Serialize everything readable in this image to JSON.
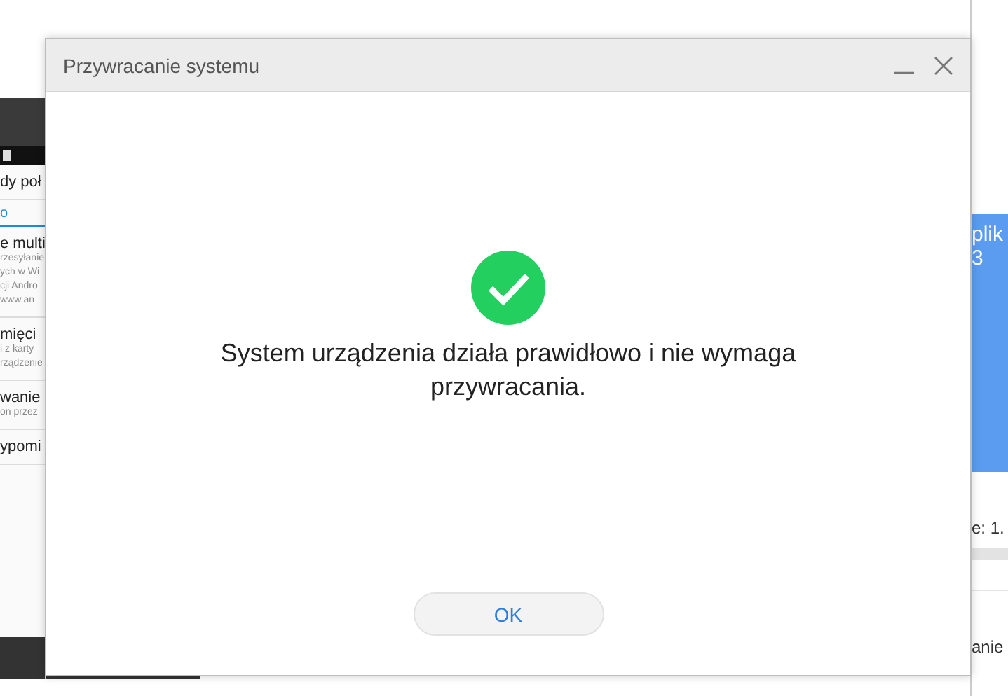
{
  "background": {
    "phone_list": [
      {
        "title": "dy poł",
        "kind": "header"
      },
      {
        "title": "o",
        "kind": "tab"
      },
      {
        "title": "e multi",
        "lines": [
          "rzesyłanie",
          "ych w Wi",
          "cji Andro",
          "www.an"
        ],
        "kind": "item"
      },
      {
        "title": "mięci",
        "lines": [
          "i z karty",
          "rządzenie"
        ],
        "kind": "item"
      },
      {
        "title": "wanie",
        "lines": [
          "on przez"
        ],
        "kind": "item"
      },
      {
        "title": "ypomi",
        "kind": "item"
      }
    ],
    "right_panel": {
      "card_lines": [
        "plik",
        "3"
      ],
      "size_text": "e: 1.",
      "footer_text": "anie"
    }
  },
  "dialog": {
    "title": "Przywracanie systemu",
    "message": "System urządzenia działa prawidłowo i nie wymaga przywracania.",
    "button": "OK"
  }
}
